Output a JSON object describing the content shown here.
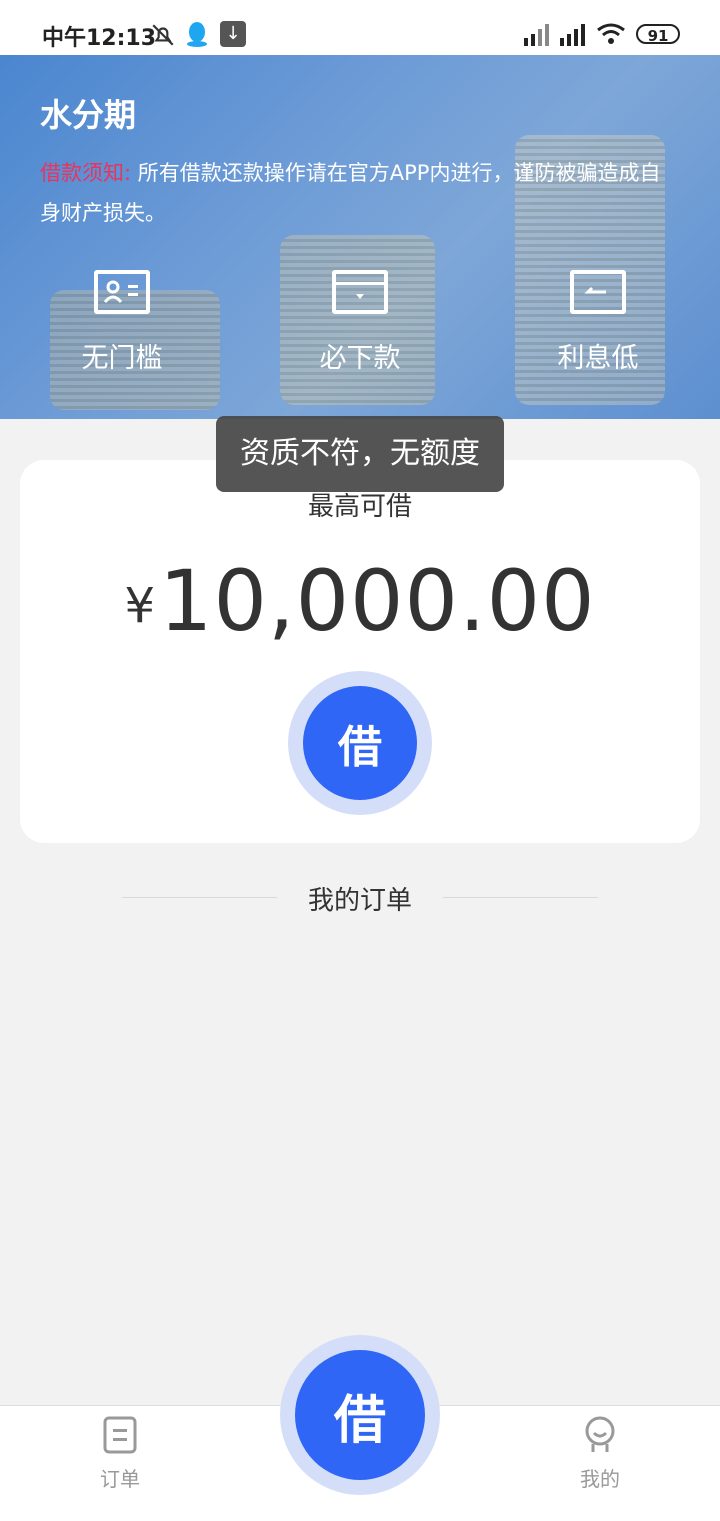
{
  "status_bar": {
    "time": "中午12:13",
    "battery": "91",
    "icons": [
      "bell-off-icon",
      "qq-icon",
      "download-icon",
      "signal-hd-icon",
      "signal-hd-icon",
      "wifi-icon",
      "battery-icon"
    ]
  },
  "header": {
    "title": "水分期",
    "notice_label": "借款须知:",
    "notice_text": " 所有借款还款操作请在官方APP内进行，谨防被骗造成自身财产损失。",
    "features": [
      {
        "label": "无门槛",
        "icon": "id-card-icon"
      },
      {
        "label": "必下款",
        "icon": "wallet-icon"
      },
      {
        "label": "利息低",
        "icon": "return-icon"
      }
    ]
  },
  "toast": "资质不符，无额度",
  "card": {
    "label": "最高可借",
    "currency": "¥",
    "amount": "10,000.00",
    "button": "借"
  },
  "orders": {
    "title": "我的订单"
  },
  "bottom_nav": {
    "orders": "订单",
    "center": "借",
    "mine": "我的"
  },
  "colors": {
    "accent": "#2f66f5",
    "notice_label": "#e8345f",
    "banner": "#5d8fd0"
  }
}
